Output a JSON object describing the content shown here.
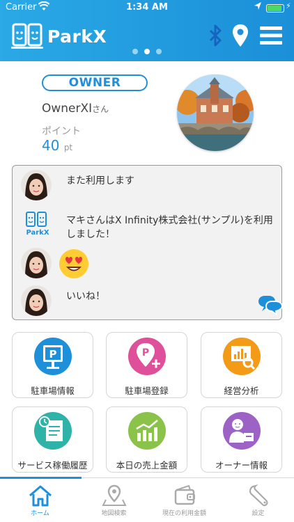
{
  "status": {
    "carrier": "Carrier",
    "time": "1:34 AM"
  },
  "header": {
    "app_name": "ParkX",
    "icons": [
      "bluetooth-icon",
      "location-pin-icon",
      "menu-icon"
    ],
    "brand_color": "#1e90d9",
    "page_dots": 3,
    "page_dots_active": 1
  },
  "profile": {
    "role": "OWNER",
    "username": "OwnerXI",
    "username_suffix": "さん",
    "points_label": "ポイント",
    "points_value": "40",
    "points_unit": "pt"
  },
  "feed": {
    "items": [
      {
        "avatar": "user-avatar",
        "text": "また利用します"
      },
      {
        "avatar": "parkx-logo",
        "logo_text": "ParkX",
        "text": "マキさんはX Infinity株式会社(サンプル)を利用しました！"
      },
      {
        "avatar": "user-avatar",
        "text": "",
        "sticker": "heart-eyes-emoji"
      },
      {
        "avatar": "user-avatar",
        "text": "いいね！"
      }
    ]
  },
  "menu": [
    {
      "label": "駐車場情報",
      "icon": "parking-info-icon",
      "color": "#1e90d9"
    },
    {
      "label": "駐車場登録",
      "icon": "parking-register-icon",
      "color": "#e0509a"
    },
    {
      "label": "経営分析",
      "icon": "analytics-icon",
      "color": "#f39a16"
    },
    {
      "label": "サービス稼働履歴",
      "icon": "service-history-icon",
      "color": "#2fb3a9"
    },
    {
      "label": "本日の売上金額",
      "icon": "sales-today-icon",
      "color": "#8bc34a"
    },
    {
      "label": "オーナー情報",
      "icon": "owner-info-icon",
      "color": "#9d62c5"
    }
  ],
  "tabs": [
    {
      "label": "ホーム",
      "icon": "home-icon",
      "active": true
    },
    {
      "label": "地図検索",
      "icon": "map-search-icon",
      "active": false
    },
    {
      "label": "現在の利用金額",
      "icon": "wallet-icon",
      "active": false
    },
    {
      "label": "設定",
      "icon": "settings-wrench-icon",
      "active": false
    }
  ]
}
